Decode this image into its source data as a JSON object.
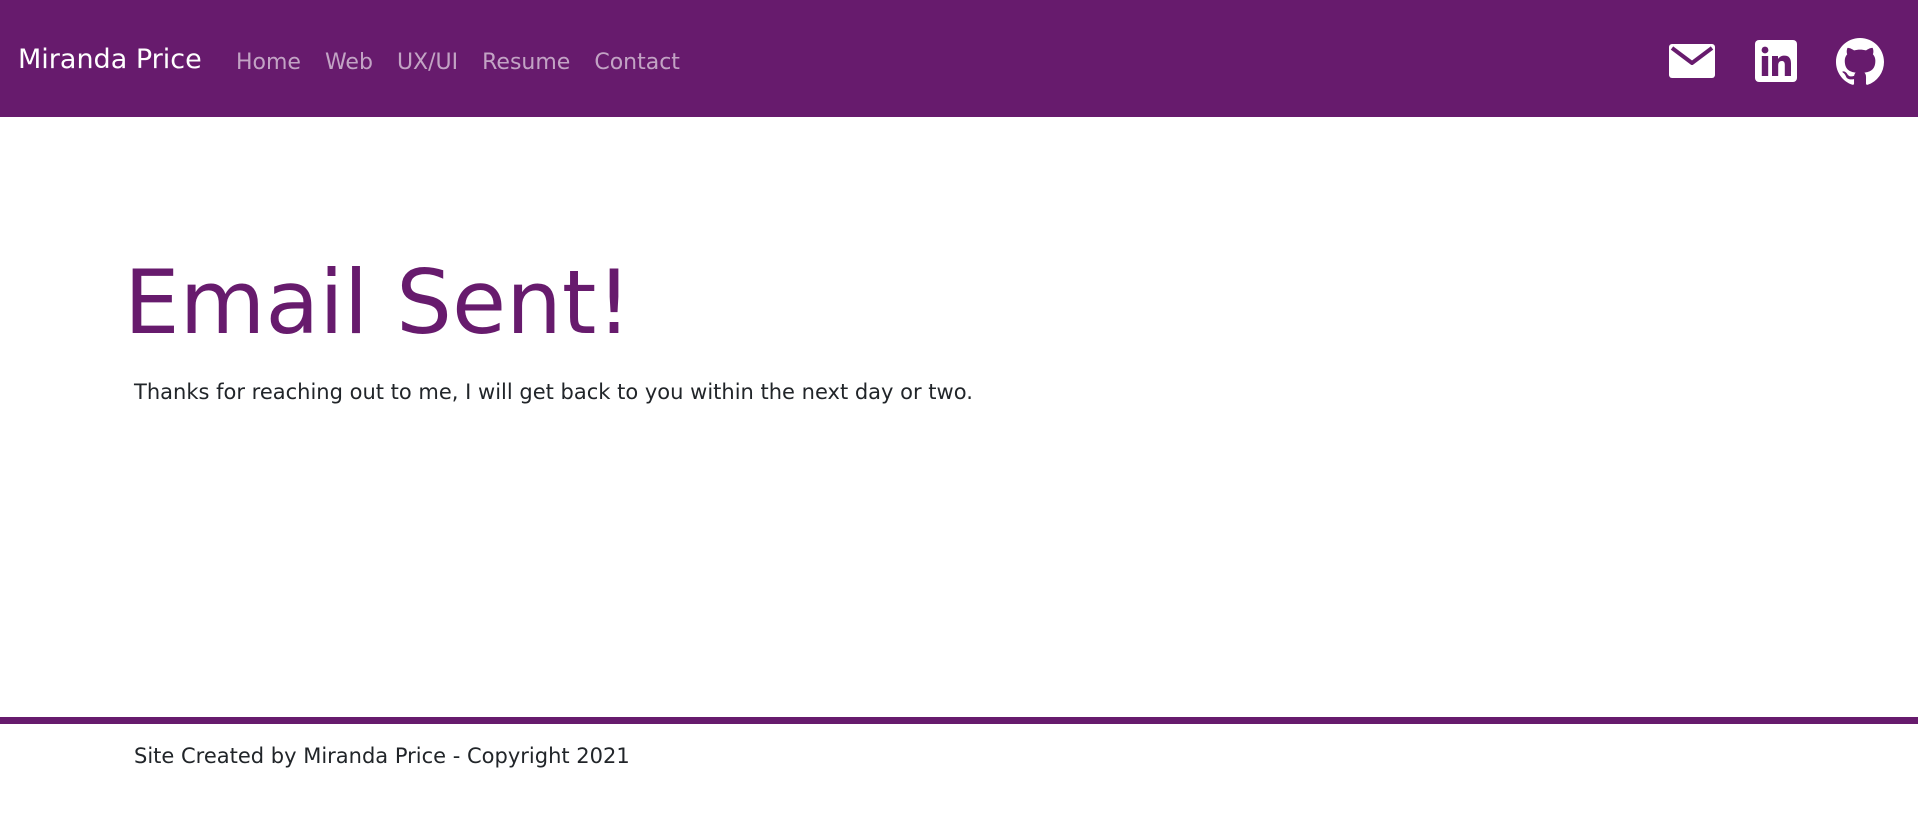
{
  "navbar": {
    "brand": "Miranda Price",
    "background": "#671b6d",
    "links": [
      {
        "label": "Home"
      },
      {
        "label": "Web"
      },
      {
        "label": "UX/UI"
      },
      {
        "label": "Resume"
      },
      {
        "label": "Contact"
      }
    ],
    "social": [
      {
        "icon": "envelope-icon"
      },
      {
        "icon": "linkedin-icon"
      },
      {
        "icon": "github-icon"
      }
    ]
  },
  "main": {
    "title": "Email Sent!",
    "message": "Thanks for reaching out to me, I will get back to you within the next day or two.",
    "title_color": "#671b6d"
  },
  "footer": {
    "text": "Site Created by Miranda Price - Copyright 2021"
  }
}
